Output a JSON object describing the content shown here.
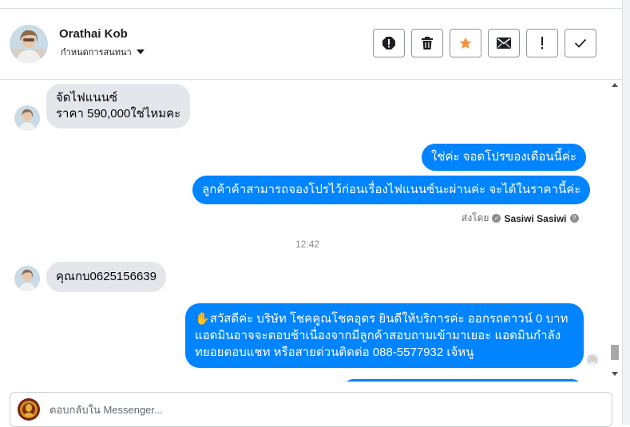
{
  "header": {
    "contact_name": "Orathai Kob",
    "subtitle": "กำหนดการสนทนา",
    "actions": [
      {
        "icon": "alert-circle-icon",
        "name": "spam-button"
      },
      {
        "icon": "trash-icon",
        "name": "delete-button"
      },
      {
        "icon": "star-icon",
        "name": "star-button"
      },
      {
        "icon": "envelope-icon",
        "name": "mark-unread-button"
      },
      {
        "icon": "exclamation-icon",
        "name": "follow-up-button"
      },
      {
        "icon": "check-icon",
        "name": "done-button"
      }
    ]
  },
  "messages": {
    "in1_line1": "จัดไฟแนนซ์",
    "in1_line2": "ราคา 590,000ใช่ไหมคะ",
    "out1": "ใช่ค่ะ จอดโปรของเดือนนี้ค่ะ",
    "out2": "ลูกค้าค้าสามารถจองโปรไว้ก่อนเรื่องไฟแนนซ์นะผ่านค่ะ จะได้ในราคานี้ค่ะ",
    "sent_by_label": "ส่งโดย",
    "sent_by_name": "Sasiwi Sasiwi",
    "timestamp": "12:42",
    "in2": "คุณกบ0625156639",
    "out3_emoji": "✋",
    "out3_line1": "สวัสดีค่ะ บริษัท โชคคูณโชคอุดร ยินดีให้บริการค่ะ ออกรถดาวน์ 0 บาท",
    "out3_line2": "แอดมินอาจจะตอบช้าเนื่องจากมีลูกค้าสอบถามเข้ามาเยอะ แอดมินกำลัง",
    "out3_line3": "ทยอยตอบแชท หรือสายด่วนติดต่อ 088-5577932 เจ้หนู"
  },
  "composer": {
    "placeholder": "ตอบกลับใน Messenger..."
  },
  "colors": {
    "outgoing_bubble": "#0084ff",
    "incoming_bubble": "#e4e6eb",
    "star_accent": "#f7923a"
  }
}
